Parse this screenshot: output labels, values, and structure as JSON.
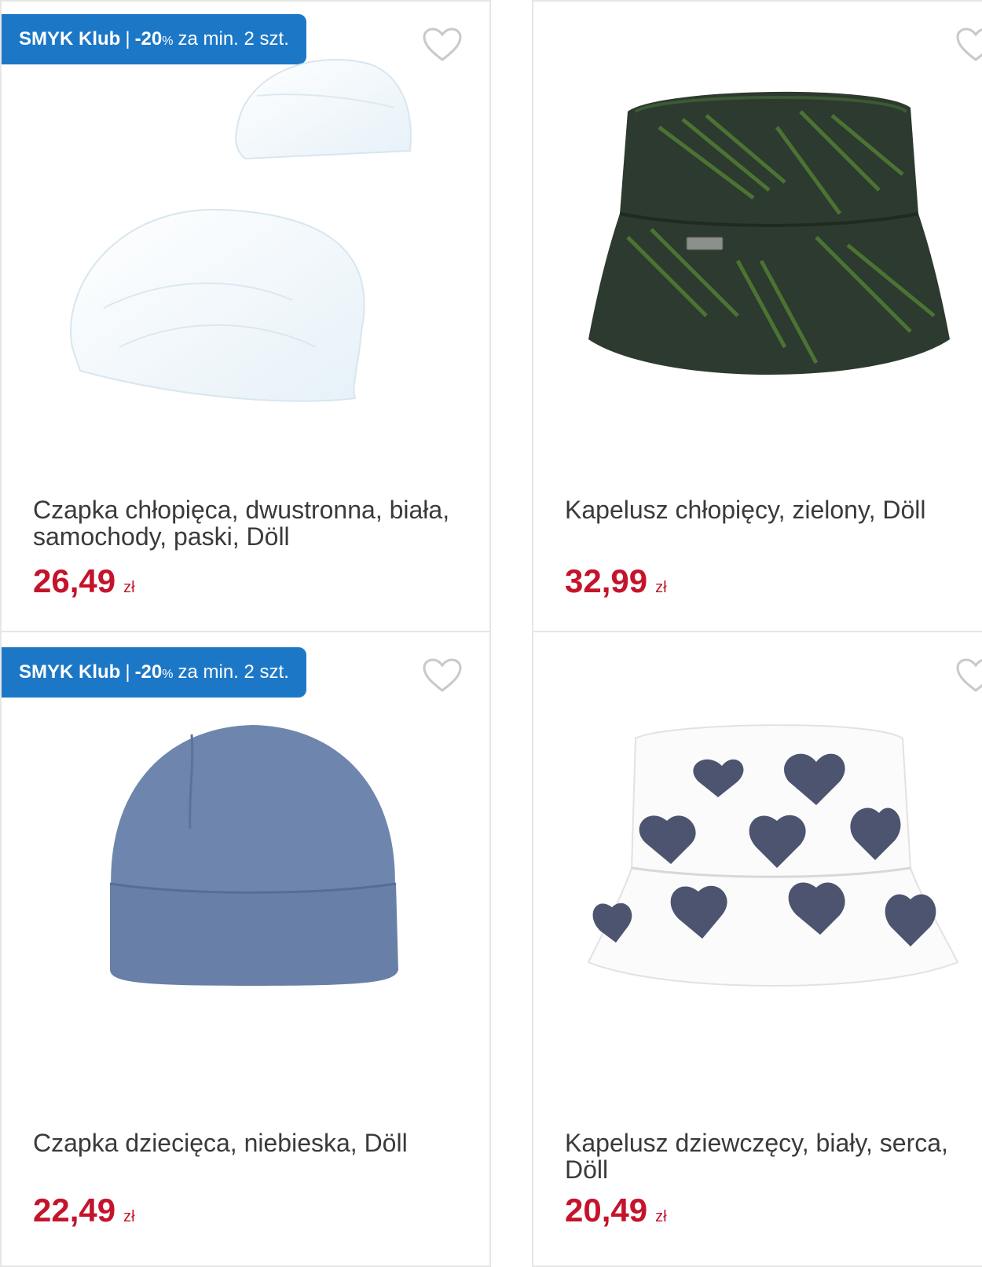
{
  "colors": {
    "badge_bg": "#1c78c7",
    "price": "#c4142c",
    "text": "#3a3a3a"
  },
  "products": [
    {
      "badge": {
        "club": "SMYK Klub",
        "sep": "|",
        "discount": "-20",
        "pct_sign": "%",
        "rest": "za min. 2 szt."
      },
      "name": "Czapka chłopięca, dwustronna, biała, samochody, paski, Döll",
      "price": "26,49",
      "currency": "zł",
      "icon": "heart-icon"
    },
    {
      "name": "Kapelusz chłopięcy, zielony, Döll",
      "price": "32,99",
      "currency": "zł",
      "icon": "heart-icon"
    },
    {
      "badge": {
        "club": "SMYK Klub",
        "sep": "|",
        "discount": "-20",
        "pct_sign": "%",
        "rest": "za min. 2 szt."
      },
      "name": "Czapka dziecięca, niebieska, Döll",
      "price": "22,49",
      "currency": "zł",
      "icon": "heart-icon"
    },
    {
      "name": "Kapelusz dziewczęcy, biały, serca, Döll",
      "price": "20,49",
      "currency": "zł",
      "icon": "heart-icon"
    }
  ]
}
